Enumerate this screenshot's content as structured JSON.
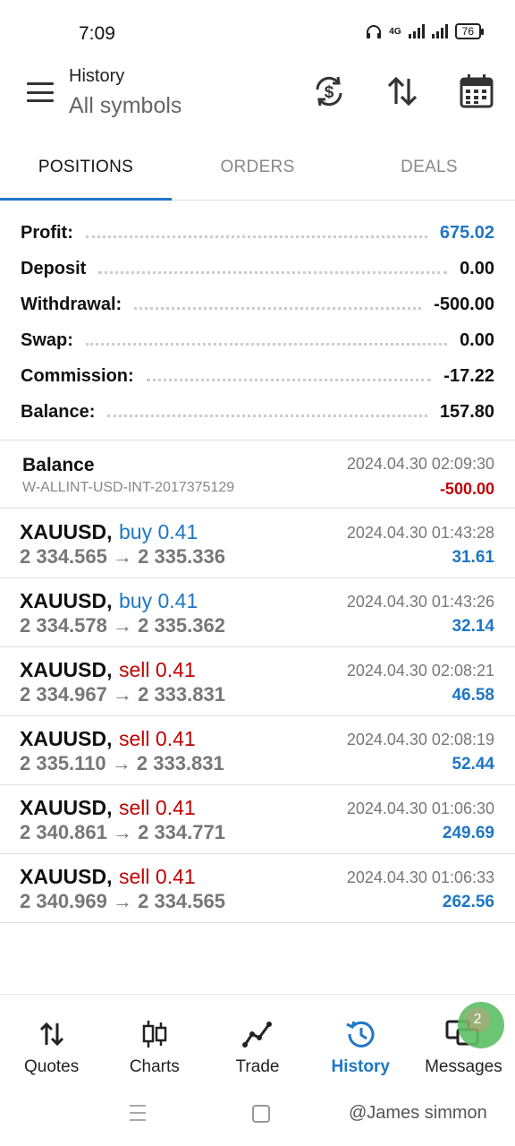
{
  "status": {
    "time": "7:09",
    "network": "4G",
    "battery": "76"
  },
  "header": {
    "title": "History",
    "subtitle": "All symbols"
  },
  "tabs": [
    {
      "label": "POSITIONS",
      "active": true
    },
    {
      "label": "ORDERS",
      "active": false
    },
    {
      "label": "DEALS",
      "active": false
    }
  ],
  "summary": [
    {
      "label": "Profit:",
      "value": "675.02",
      "color": "#1f76c5"
    },
    {
      "label": "Deposit",
      "value": "0.00"
    },
    {
      "label": "Withdrawal:",
      "value": "-500.00"
    },
    {
      "label": "Swap:",
      "value": "0.00"
    },
    {
      "label": "Commission:",
      "value": "-17.22"
    },
    {
      "label": "Balance:",
      "value": "157.80"
    }
  ],
  "balance_item": {
    "title": "Balance",
    "comment": "W-ALLINT-USD-INT-2017375129",
    "date": "2024.04.30 02:09:30",
    "value": "-500.00"
  },
  "deals": [
    {
      "symbol": "XAUUSD,",
      "side": "buy 0.41",
      "side_type": "buy",
      "price": "2 334.565 → 2 335.336",
      "date": "2024.04.30 01:43:28",
      "profit": "31.61"
    },
    {
      "symbol": "XAUUSD,",
      "side": "buy 0.41",
      "side_type": "buy",
      "price": "2 334.578 → 2 335.362",
      "date": "2024.04.30 01:43:26",
      "profit": "32.14"
    },
    {
      "symbol": "XAUUSD,",
      "side": "sell 0.41",
      "side_type": "sell",
      "price": "2 334.967 → 2 333.831",
      "date": "2024.04.30 02:08:21",
      "profit": "46.58"
    },
    {
      "symbol": "XAUUSD,",
      "side": "sell 0.41",
      "side_type": "sell",
      "price": "2 335.110 → 2 333.831",
      "date": "2024.04.30 02:08:19",
      "profit": "52.44"
    },
    {
      "symbol": "XAUUSD,",
      "side": "sell 0.41",
      "side_type": "sell",
      "price": "2 340.861 → 2 334.771",
      "date": "2024.04.30 01:06:30",
      "profit": "249.69"
    },
    {
      "symbol": "XAUUSD,",
      "side": "sell 0.41",
      "side_type": "sell",
      "price": "2 340.969 → 2 334.565",
      "date": "2024.04.30 01:06:33",
      "profit": "262.56"
    }
  ],
  "colors": {
    "accent": "#1f76c5",
    "buy": "#1f76c5",
    "sell": "#c00000"
  },
  "bottom_nav": [
    {
      "label": "Quotes",
      "icon": "quotes-icon"
    },
    {
      "label": "Charts",
      "icon": "charts-icon"
    },
    {
      "label": "Trade",
      "icon": "trade-icon"
    },
    {
      "label": "History",
      "icon": "history-icon",
      "active": true
    },
    {
      "label": "Messages",
      "icon": "messages-icon",
      "badge": "2"
    }
  ],
  "watermark": "@James simmon"
}
